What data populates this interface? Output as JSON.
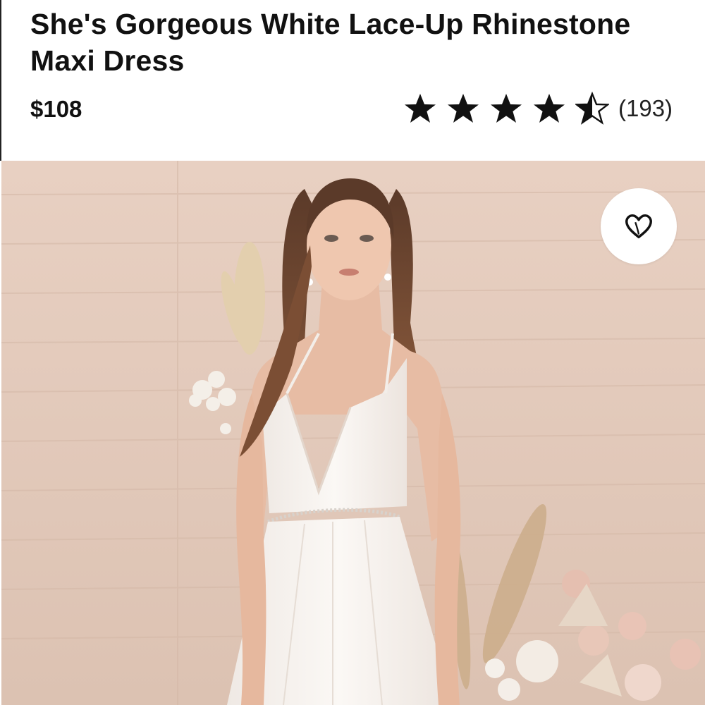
{
  "product": {
    "title": "She's Gorgeous White Lace-Up Rhinestone Maxi Dress",
    "price": "$108",
    "rating": {
      "value": 4.5,
      "max": 5,
      "review_count": "(193)"
    }
  },
  "hero_image": {
    "description_icon": "product-photo",
    "favorite_icon": "heart-icon"
  },
  "colors": {
    "background_wall": "#e6cdbf",
    "dress": "#f7f3ef",
    "star": "#111111"
  }
}
